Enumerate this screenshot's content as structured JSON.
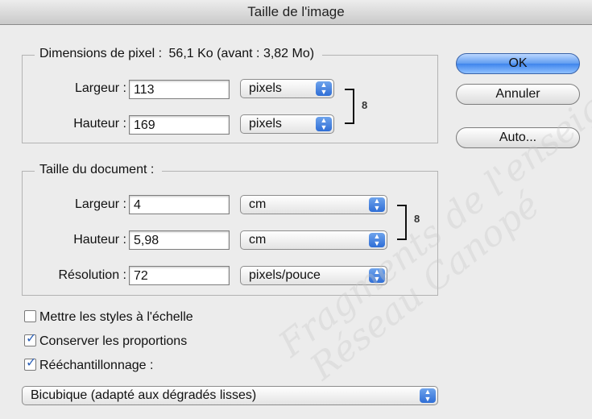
{
  "window": {
    "title": "Taille de l'image"
  },
  "pixel_dimensions": {
    "label": "Dimensions de pixel :",
    "size_info": "56,1 Ko (avant : 3,82 Mo)",
    "width": {
      "label": "Largeur :",
      "value": "113",
      "unit": "pixels"
    },
    "height": {
      "label": "Hauteur :",
      "value": "169",
      "unit": "pixels"
    }
  },
  "document_size": {
    "label": "Taille du document :",
    "width": {
      "label": "Largeur :",
      "value": "4",
      "unit": "cm"
    },
    "height": {
      "label": "Hauteur :",
      "value": "5,98",
      "unit": "cm"
    },
    "resolution": {
      "label": "Résolution :",
      "value": "72",
      "unit": "pixels/pouce"
    }
  },
  "buttons": {
    "ok": "OK",
    "cancel": "Annuler",
    "auto": "Auto..."
  },
  "options": {
    "scale_styles": {
      "label": "Mettre les styles à l'échelle",
      "checked": false
    },
    "constrain_proportions": {
      "label": "Conserver les proportions",
      "checked": true
    },
    "resample": {
      "label": "Rééchantillonnage :",
      "checked": true
    }
  },
  "resample_method": "Bicubique (adapté aux dégradés lisses)",
  "watermark": {
    "line1": "Fragments de l'enseig",
    "line2": "Réseau Canopé"
  },
  "colors": {
    "accent": "#3f85ec",
    "check": "#2f62b8"
  }
}
